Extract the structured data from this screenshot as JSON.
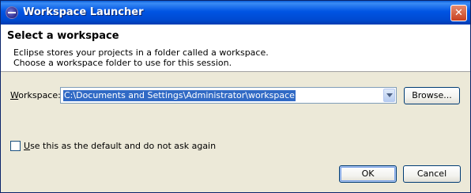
{
  "window": {
    "title": "Workspace Launcher",
    "close_glyph": "✕"
  },
  "banner": {
    "heading": "Select a workspace",
    "description_line1": "Eclipse stores your projects in a folder called a workspace.",
    "description_line2": "Choose a workspace folder to use for this session."
  },
  "workspace": {
    "label_mnemonic": "W",
    "label_rest": "orkspace:",
    "value": "C:\\Documents and Settings\\Administrator\\workspace",
    "browse_label": "Browse..."
  },
  "default_option": {
    "checked": false,
    "label_mnemonic": "U",
    "label_rest": "se this as the default and do not ask again"
  },
  "buttons": {
    "ok_label": "OK",
    "cancel_label": "Cancel"
  },
  "icons": {
    "app": "eclipse-icon",
    "close": "close-icon",
    "dropdown": "chevron-down-icon"
  },
  "colors": {
    "titlebar": "#0054e3",
    "selection": "#316ac5",
    "close": "#c8401f"
  }
}
